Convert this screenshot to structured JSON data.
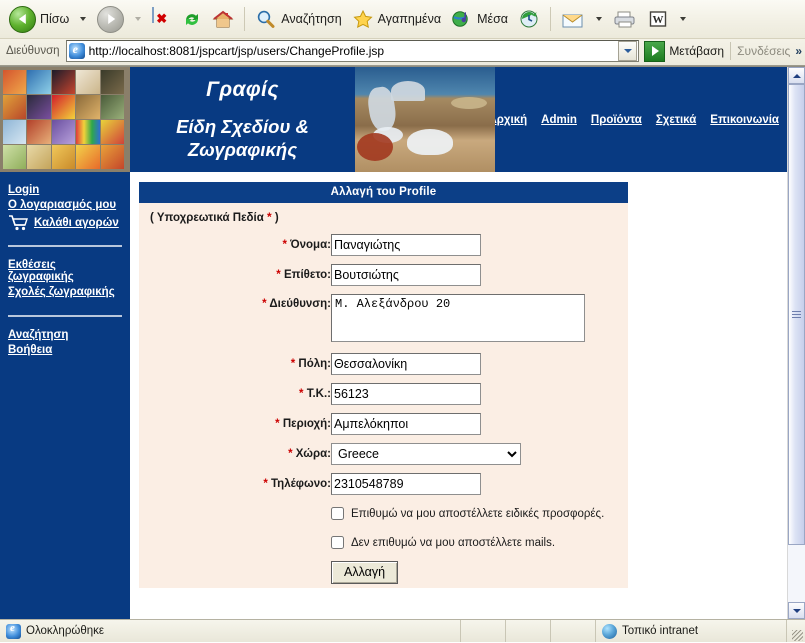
{
  "browser": {
    "toolbar": {
      "back_label": "Πίσω",
      "forward_label": "",
      "stop_icon": "stop-icon",
      "refresh_icon": "refresh-icon",
      "home_icon": "home-icon",
      "search_label": "Αναζήτηση",
      "favorites_label": "Αγαπημένα",
      "media_label": "Μέσα",
      "history_icon": "history-icon",
      "mail_icon": "mail-icon",
      "print_icon": "print-icon",
      "edit_icon": "word-edit-icon"
    },
    "address": {
      "label": "Διεύθυνση",
      "url": "http://localhost:8081/jspcart/jsp/users/ChangeProfile.jsp",
      "go_label": "Μετάβαση",
      "links_label": "Συνδέσεις",
      "overflow_label": "»"
    },
    "statusbar": {
      "status": "Ολοκληρώθηκε",
      "zone": "Τοπικό intranet"
    }
  },
  "site": {
    "banner": {
      "title_line1": "Γραφίς",
      "title_line2": "Είδη Σχεδίου &",
      "title_line3": "Ζωγραφικής"
    },
    "nav": [
      {
        "label": "Αρχική"
      },
      {
        "label": "Admin"
      },
      {
        "label": "Προϊόντα"
      },
      {
        "label": "Σχετικά"
      },
      {
        "label": "Επικοινωνία"
      }
    ],
    "sidebar": {
      "group1": [
        {
          "label": "Login"
        },
        {
          "label": "Ο λογαριασμός μου"
        }
      ],
      "cart_label": "Καλάθι αγορών",
      "group2": [
        {
          "label": "Εκθέσεις ζωγραφικής"
        },
        {
          "label": "Σχολές ζωγραφικής"
        }
      ],
      "group3": [
        {
          "label": "Αναζήτηση"
        },
        {
          "label": "Βοήθεια"
        }
      ]
    }
  },
  "form": {
    "title": "Αλλαγή του Profile",
    "required_note_prefix": "( Υποχρεωτικά Πεδία ",
    "required_note_star": "*",
    "required_note_suffix": " )",
    "star": "*",
    "fields": {
      "firstname": {
        "label": "Όνομα:",
        "value": "Παναγιώτης"
      },
      "lastname": {
        "label": "Επίθετο:",
        "value": "Βουτσιώτης"
      },
      "address": {
        "label": "Διεύθυνση:",
        "value": "Μ. Αλεξάνδρου 20"
      },
      "city": {
        "label": "Πόλη:",
        "value": "Θεσσαλονίκη"
      },
      "zip": {
        "label": "Τ.Κ.:",
        "value": "56123"
      },
      "area": {
        "label": "Περιοχή:",
        "value": "Αμπελόκηποι"
      },
      "country": {
        "label": "Χώρα:",
        "value": "Greece",
        "options": [
          "Greece"
        ]
      },
      "phone": {
        "label": "Τηλέφωνο:",
        "value": "2310548789"
      }
    },
    "checkboxes": [
      {
        "label": "Επιθυμώ να μου αποστέλλετε ειδικές προσφορές.",
        "checked": false
      },
      {
        "label": "Δεν επιθυμώ να μου αποστέλλετε mails.",
        "checked": false
      }
    ],
    "submit_label": "Αλλαγή"
  },
  "colors": {
    "brand_blue": "#083a82",
    "title_bar": "#0c3f87",
    "form_bg": "#fbeee4",
    "required_red": "#cc0000"
  }
}
